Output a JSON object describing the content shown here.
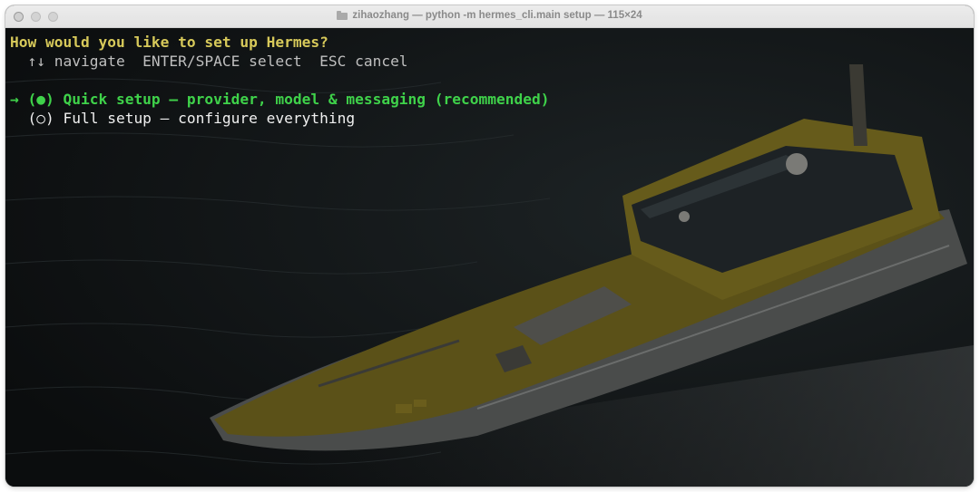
{
  "window": {
    "title": "zihaozhang — python -m hermes_cli.main setup — 115×24",
    "folder_icon": "folder-icon"
  },
  "terminal": {
    "prompt": "How would you like to set up Hermes?",
    "hint": "  ↑↓ navigate  ENTER/SPACE select  ESC cancel",
    "options": [
      {
        "label": "→ (●) Quick setup — provider, model & messaging (recommended)",
        "selected": true
      },
      {
        "label": "  (○) Full setup — configure everything",
        "selected": false
      }
    ],
    "background_image": "pilot boat on dark sea"
  },
  "colors": {
    "prompt": "#d7c95a",
    "selected": "#3fd24a",
    "hint": "#bfbfbf",
    "text": "#f0f0f0",
    "background": "#0e1111"
  }
}
